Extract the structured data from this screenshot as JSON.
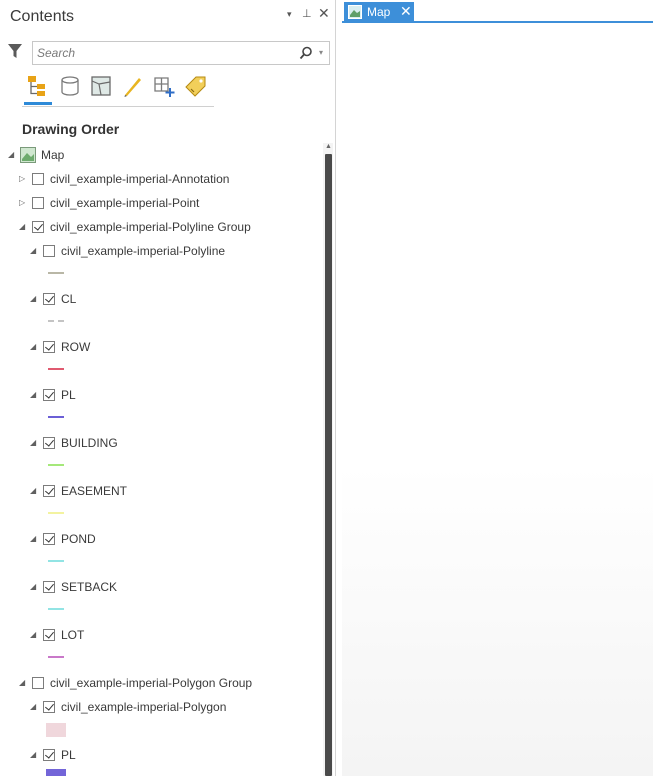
{
  "contents": {
    "title": "Contents",
    "controls": {
      "dropdown": "▾",
      "pin": "⊥",
      "close": "✕"
    },
    "search": {
      "placeholder": "Search",
      "value": ""
    },
    "view_tabs": [
      "list-by-drawing-order-icon",
      "list-by-data-source-icon",
      "list-by-selection-icon",
      "list-by-editing-icon",
      "list-by-snapping-icon",
      "list-by-labeling-icon"
    ],
    "section_heading": "Drawing Order"
  },
  "tree": {
    "map": "Map",
    "items": [
      {
        "label": "civil_example-imperial-Annotation",
        "checked": false,
        "expanded": false
      },
      {
        "label": "civil_example-imperial-Point",
        "checked": false,
        "expanded": false
      },
      {
        "label": "civil_example-imperial-Polyline Group",
        "checked": true,
        "expanded": true
      },
      {
        "label": "civil_example-imperial-Polyline",
        "checked": false,
        "expanded": true
      },
      {
        "label": "CL",
        "checked": true,
        "expanded": true
      },
      {
        "label": "ROW",
        "checked": true,
        "expanded": true
      },
      {
        "label": "PL",
        "checked": true,
        "expanded": true
      },
      {
        "label": "BUILDING",
        "checked": true,
        "expanded": true
      },
      {
        "label": "EASEMENT",
        "checked": true,
        "expanded": true
      },
      {
        "label": "POND",
        "checked": true,
        "expanded": true
      },
      {
        "label": "SETBACK",
        "checked": true,
        "expanded": true
      },
      {
        "label": "LOT",
        "checked": true,
        "expanded": true
      },
      {
        "label": "civil_example-imperial-Polygon Group",
        "checked": false,
        "expanded": true
      },
      {
        "label": "civil_example-imperial-Polygon",
        "checked": true,
        "expanded": true
      },
      {
        "label": "PL",
        "checked": true,
        "expanded": true
      }
    ],
    "symbols": {
      "polyline": "#b9b7a6",
      "cl": "#b9b9b9",
      "row": "#e05a70",
      "pl": "#6b5fd6",
      "building": "#a5e87a",
      "easement": "#f3f3a0",
      "pond": "#92e4e4",
      "setback": "#92e4e4",
      "lot": "#c978c9",
      "polygon_fill": "#f0d7dc",
      "polygon_pl_fill": "#7365d8"
    }
  },
  "map_view": {
    "tab_label": "Map",
    "tab_close": "✕",
    "accent": "#3d8fd9"
  }
}
